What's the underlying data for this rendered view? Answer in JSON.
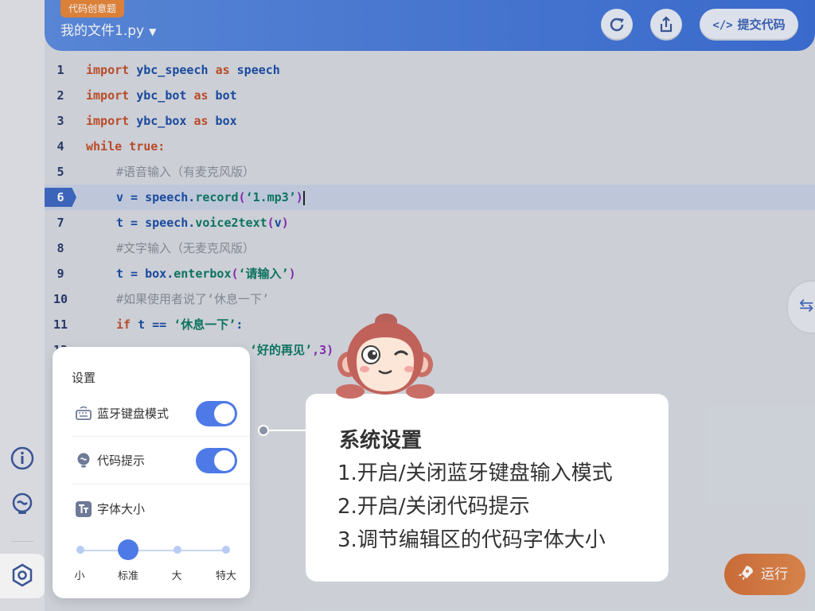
{
  "header": {
    "badge": "代码创意题",
    "filename": "我的文件1.py",
    "submit_label": "提交代码",
    "submit_icon": "</>"
  },
  "editor": {
    "active_line": 6,
    "lines": [
      {
        "n": "1"
      },
      {
        "n": "2"
      },
      {
        "n": "3"
      },
      {
        "n": "4"
      },
      {
        "n": "5"
      },
      {
        "n": "6"
      },
      {
        "n": "7"
      },
      {
        "n": "8"
      },
      {
        "n": "9"
      },
      {
        "n": "10"
      },
      {
        "n": "11"
      },
      {
        "n": "12"
      }
    ],
    "code": {
      "l1": {
        "kw1": "import",
        "mod": " ybc_speech ",
        "kw2": "as",
        "alias": " speech"
      },
      "l2": {
        "kw1": "import",
        "mod": " ybc_bot ",
        "kw2": "as",
        "alias": " bot"
      },
      "l3": {
        "kw1": "import",
        "mod": " ybc_box ",
        "kw2": "as",
        "alias": " box"
      },
      "l4": {
        "kw": "while true:"
      },
      "l5": {
        "comment": "#语音输入（有麦克风版）"
      },
      "l6": {
        "pre": "v = speech.",
        "fn": "record",
        "p1": "(",
        "str": "‘1.mp3’",
        "p2": ")"
      },
      "l7": {
        "pre": "t = speech.",
        "fn": "voice2text",
        "p1": "(",
        "arg": "v",
        "p2": ")"
      },
      "l8": {
        "comment": "#文字输入（无麦克风版）"
      },
      "l9": {
        "pre": "t = box.",
        "fn": "enterbox",
        "p1": "(",
        "str": "‘请输入’",
        "p2": ")"
      },
      "l10": {
        "comment": "#如果使用者说了‘休息一下’"
      },
      "l11": {
        "kw": "if",
        "mid": " t == ",
        "str": "‘休息一下’",
        "colon": ":"
      },
      "l12": {
        "pre": "",
        "str": "‘好的再见’",
        "tail": ",3)"
      }
    }
  },
  "run_button": {
    "label": "运行"
  },
  "settings": {
    "title": "设置",
    "bluetooth_label": "蓝牙键盘模式",
    "bluetooth_on": true,
    "hint_label": "代码提示",
    "hint_on": true,
    "font_label": "字体大小",
    "font_sizes": [
      "小",
      "标准",
      "大",
      "特大"
    ],
    "font_selected": "标准"
  },
  "callout": {
    "title": "系统设置",
    "items": [
      "1.开启/关闭蓝牙键盘输入模式",
      "2.开启/关闭代码提示",
      "3.调节编辑区的代码字体大小"
    ]
  },
  "icons": {
    "rail": [
      "info-icon",
      "lightbulb-icon",
      "settings-hex-icon"
    ],
    "header": [
      "refresh-icon",
      "share-icon"
    ],
    "side": "swap-icon"
  },
  "colors": {
    "header_blue": "#4f80db",
    "keyword": "#c4502a",
    "identifier": "#1b4ea5",
    "string": "#0d7a63",
    "accent_orange": "#e38a4d",
    "toggle_blue": "#4d7ae6"
  }
}
